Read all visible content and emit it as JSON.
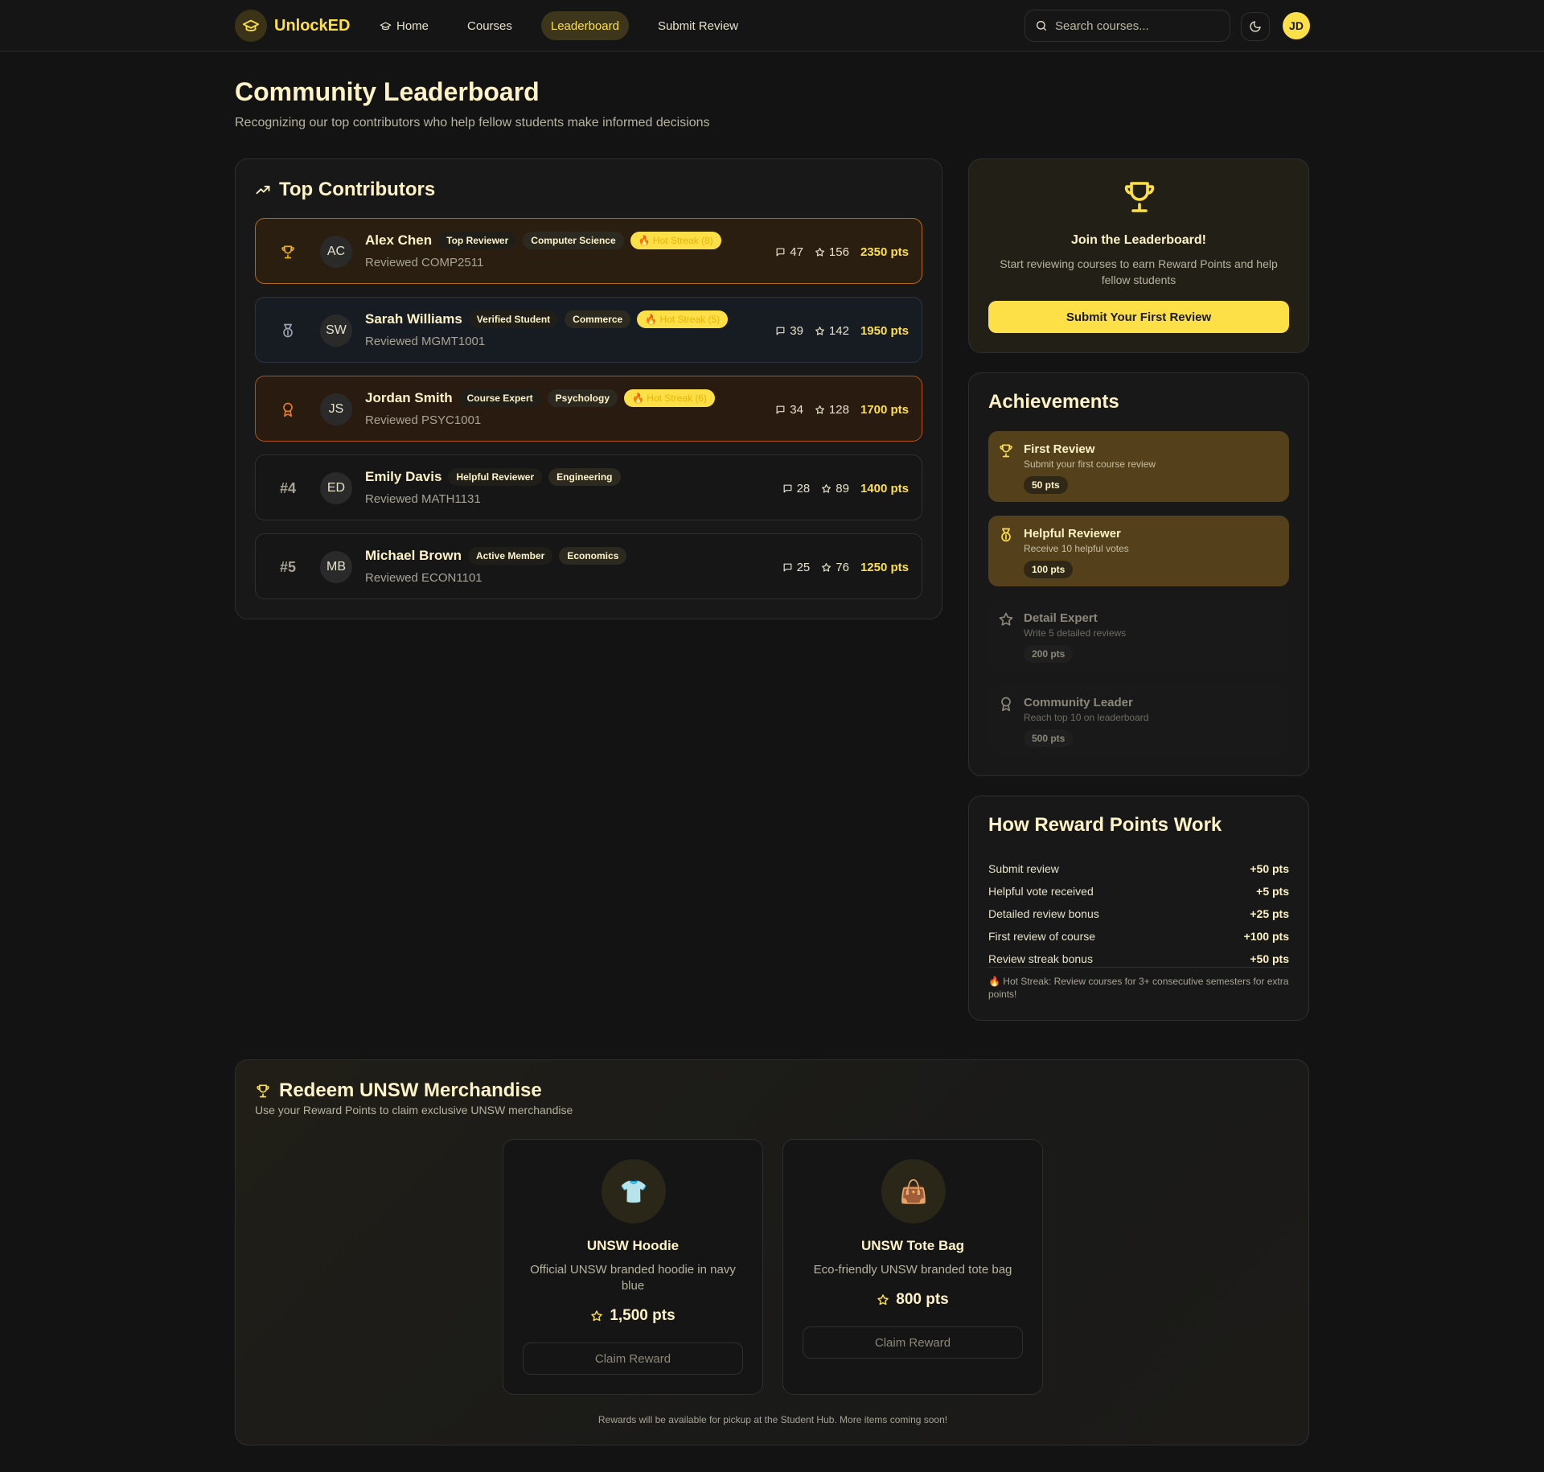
{
  "nav": {
    "brand": "UnlockED",
    "links": [
      {
        "label": "Home",
        "active": false
      },
      {
        "label": "Courses",
        "active": false
      },
      {
        "label": "Leaderboard",
        "active": true
      },
      {
        "label": "Submit Review",
        "active": false
      }
    ],
    "search_placeholder": "Search courses...",
    "user_initials": "JD"
  },
  "header": {
    "title": "Community Leaderboard",
    "subtitle": "Recognizing our top contributors who help fellow students make informed decisions"
  },
  "contributors": {
    "title": "Top Contributors",
    "rows": [
      {
        "rank": "",
        "rank_icon": "trophy-icon",
        "initials": "AC",
        "name": "Alex Chen",
        "role": "Top Reviewer",
        "faculty": "Computer Science",
        "streak": "🔥 Hot Streak (8)",
        "reviewed": "Reviewed COMP2511",
        "reviews": "47",
        "helpful": "156",
        "points": "2350 pts"
      },
      {
        "rank": "",
        "rank_icon": "medal-icon",
        "initials": "SW",
        "name": "Sarah Williams",
        "role": "Verified Student",
        "faculty": "Commerce",
        "streak": "🔥 Hot Streak (5)",
        "reviewed": "Reviewed MGMT1001",
        "reviews": "39",
        "helpful": "142",
        "points": "1950 pts"
      },
      {
        "rank": "",
        "rank_icon": "award-icon",
        "initials": "JS",
        "name": "Jordan Smith",
        "role": "Course Expert",
        "faculty": "Psychology",
        "streak": "🔥 Hot Streak (6)",
        "reviewed": "Reviewed PSYC1001",
        "reviews": "34",
        "helpful": "128",
        "points": "1700 pts"
      },
      {
        "rank": "#4",
        "rank_icon": "",
        "initials": "ED",
        "name": "Emily Davis",
        "role": "Helpful Reviewer",
        "faculty": "Engineering",
        "streak": "",
        "reviewed": "Reviewed MATH1131",
        "reviews": "28",
        "helpful": "89",
        "points": "1400 pts"
      },
      {
        "rank": "#5",
        "rank_icon": "",
        "initials": "MB",
        "name": "Michael Brown",
        "role": "Active Member",
        "faculty": "Economics",
        "streak": "",
        "reviewed": "Reviewed ECON1101",
        "reviews": "25",
        "helpful": "76",
        "points": "1250 pts"
      }
    ]
  },
  "join": {
    "title": "Join the Leaderboard!",
    "text": "Start reviewing courses to earn Reward Points and help fellow students",
    "button": "Submit Your First Review"
  },
  "achievements": {
    "title": "Achievements",
    "items": [
      {
        "icon": "trophy-icon",
        "name": "First Review",
        "desc": "Submit your first course review",
        "points": "50 pts",
        "unlocked": true
      },
      {
        "icon": "medal-icon",
        "name": "Helpful Reviewer",
        "desc": "Receive 10 helpful votes",
        "points": "100 pts",
        "unlocked": true
      },
      {
        "icon": "star-icon",
        "name": "Detail Expert",
        "desc": "Write 5 detailed reviews",
        "points": "200 pts",
        "unlocked": false
      },
      {
        "icon": "award-icon",
        "name": "Community Leader",
        "desc": "Reach top 10 on leaderboard",
        "points": "500 pts",
        "unlocked": false
      }
    ]
  },
  "points": {
    "title": "How Reward Points Work",
    "rules": [
      {
        "label": "Submit review",
        "value": "+50 pts"
      },
      {
        "label": "Helpful vote received",
        "value": "+5 pts"
      },
      {
        "label": "Detailed review bonus",
        "value": "+25 pts"
      },
      {
        "label": "First review of course",
        "value": "+100 pts"
      },
      {
        "label": "Review streak bonus",
        "value": "+50 pts"
      }
    ],
    "note": "🔥 Hot Streak: Review courses for 3+ consecutive semesters for extra points!"
  },
  "merch": {
    "title": "Redeem UNSW Merchandise",
    "subtitle": "Use your Reward Points to claim exclusive UNSW merchandise",
    "items": [
      {
        "emoji": "👕",
        "name": "UNSW Hoodie",
        "desc": "Official UNSW branded hoodie in navy blue",
        "price": "1,500 pts",
        "button": "Claim Reward"
      },
      {
        "emoji": "👜",
        "name": "UNSW Tote Bag",
        "desc": "Eco-friendly UNSW branded tote bag",
        "price": "800 pts",
        "button": "Claim Reward"
      }
    ],
    "footer": "Rewards will be available for pickup at the Student Hub. More items coming soon!"
  },
  "colors": {
    "accent": "#fde047",
    "background": "#131313",
    "gold_border": "#b36a16",
    "bronze_border": "#b1540f",
    "unlocked_achievement": "#54401a"
  }
}
